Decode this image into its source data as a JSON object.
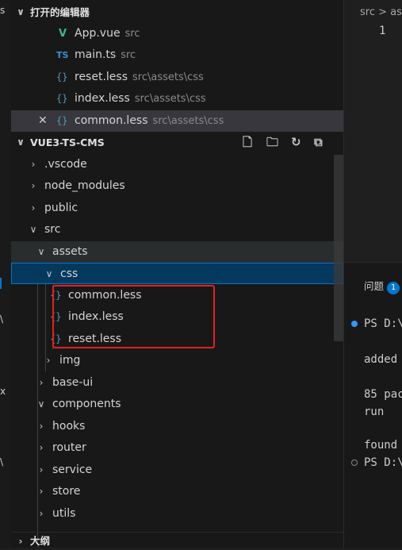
{
  "open_editors": {
    "header": "打开的编辑器",
    "items": [
      {
        "label": "App.vue",
        "desc": "src",
        "icon": "vue-file-icon"
      },
      {
        "label": "main.ts",
        "desc": "src",
        "icon": "ts-file-icon",
        "icon_text": "TS"
      },
      {
        "label": "reset.less",
        "desc": "src\\assets\\css",
        "icon": "less-file-icon"
      },
      {
        "label": "index.less",
        "desc": "src\\assets\\css",
        "icon": "less-file-icon"
      },
      {
        "label": "common.less",
        "desc": "src\\assets\\css",
        "icon": "less-file-icon",
        "active": true
      }
    ]
  },
  "explorer": {
    "header": "VUE3-TS-CMS",
    "tree": [
      {
        "label": ".vscode",
        "type": "folder",
        "expanded": false
      },
      {
        "label": "node_modules",
        "type": "folder",
        "expanded": false
      },
      {
        "label": "public",
        "type": "folder",
        "expanded": false
      },
      {
        "label": "src",
        "type": "folder",
        "expanded": true
      },
      {
        "label": "assets",
        "type": "folder",
        "expanded": true
      },
      {
        "label": "css",
        "type": "folder",
        "expanded": true
      },
      {
        "label": "common.less",
        "type": "file"
      },
      {
        "label": "index.less",
        "type": "file"
      },
      {
        "label": "reset.less",
        "type": "file"
      },
      {
        "label": "img",
        "type": "folder",
        "expanded": false
      },
      {
        "label": "base-ui",
        "type": "folder",
        "expanded": false
      },
      {
        "label": "components",
        "type": "folder",
        "expanded": true
      },
      {
        "label": "hooks",
        "type": "folder",
        "expanded": false
      },
      {
        "label": "router",
        "type": "folder",
        "expanded": false
      },
      {
        "label": "service",
        "type": "folder",
        "expanded": false
      },
      {
        "label": "store",
        "type": "folder",
        "expanded": false
      },
      {
        "label": "utils",
        "type": "folder",
        "expanded": false
      }
    ]
  },
  "outline": {
    "header": "大纲"
  },
  "editor": {
    "breadcrumb": "src > as",
    "line_number": "1"
  },
  "panel": {
    "tab_label": "问题",
    "badge": "1",
    "terminal_lines": [
      "PS D:\\",
      "added",
      "85 pac",
      "  run",
      "found",
      "PS D:\\"
    ]
  },
  "colors": {
    "accent": "#0078d4",
    "highlight_box": "#e51f1f",
    "vue": "#41b883",
    "ts": "#3d8fd6"
  }
}
